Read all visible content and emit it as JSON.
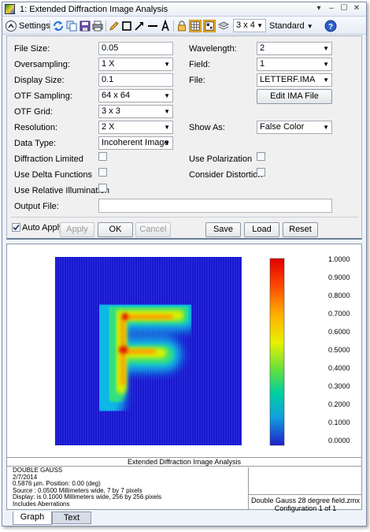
{
  "window": {
    "title": "1: Extended Diffraction Image Analysis",
    "controls": [
      "▾",
      "‒",
      "☐",
      "✕"
    ]
  },
  "toolbar": {
    "settings_label": "Settings",
    "layout_value": "3 x 4",
    "mode_value": "Standard",
    "help_icon": "?"
  },
  "form": {
    "file_size": {
      "label": "File Size:",
      "value": "0.05"
    },
    "oversampling": {
      "label": "Oversampling:",
      "value": "1 X"
    },
    "display_size": {
      "label": "Display Size:",
      "value": "0.1"
    },
    "otf_sampling": {
      "label": "OTF Sampling:",
      "value": "64 x 64"
    },
    "otf_grid": {
      "label": "OTF Grid:",
      "value": "3 x 3"
    },
    "resolution": {
      "label": "Resolution:",
      "value": "2 X"
    },
    "data_type": {
      "label": "Data Type:",
      "value": "Incoherent Image"
    },
    "diffraction_limited": {
      "label": "Diffraction Limited"
    },
    "use_delta_functions": {
      "label": "Use Delta Functions"
    },
    "use_relative_illumination": {
      "label": "Use Relative Illumination"
    },
    "output_file": {
      "label": "Output File:",
      "value": ""
    },
    "wavelength": {
      "label": "Wavelength:",
      "value": "2"
    },
    "field": {
      "label": "Field:",
      "value": "1"
    },
    "file": {
      "label": "File:",
      "value": "LETTERF.IMA"
    },
    "edit_ima_file": "Edit IMA File",
    "show_as": {
      "label": "Show As:",
      "value": "False Color"
    },
    "use_polarization": {
      "label": "Use Polarization"
    },
    "consider_distortion": {
      "label": "Consider Distortion"
    }
  },
  "actions": {
    "auto_apply": "Auto Apply",
    "apply": "Apply",
    "ok": "OK",
    "cancel": "Cancel",
    "save": "Save",
    "load": "Load",
    "reset": "Reset"
  },
  "graph": {
    "colorbar_labels": [
      "1.0000",
      "0.9000",
      "0.8000",
      "0.7000",
      "0.6000",
      "0.5000",
      "0.4000",
      "0.3000",
      "0.2000",
      "0.1000",
      "0.0000"
    ],
    "footer_title": "Extended Diffraction Image Analysis",
    "info_lines": [
      "DOUBLE GAUSS",
      "2/7/2014",
      "0.5876 µm. Position: 0.00 (deg)",
      "Source : 0.0500 Millimeters wide, 7 by 7 pixels",
      "Display: is 0.1000 Millimeters wide, 256 by 256 pixels",
      "Includes Aberrations"
    ],
    "file_name": "Double Gauss 28 degree field.zmx",
    "configuration": "Configuration 1 of 1"
  },
  "tabs": {
    "graph": "Graph",
    "text": "Text"
  },
  "colors": {
    "accent_orange": "#f5b93a",
    "plot_background": "#1010c8"
  }
}
